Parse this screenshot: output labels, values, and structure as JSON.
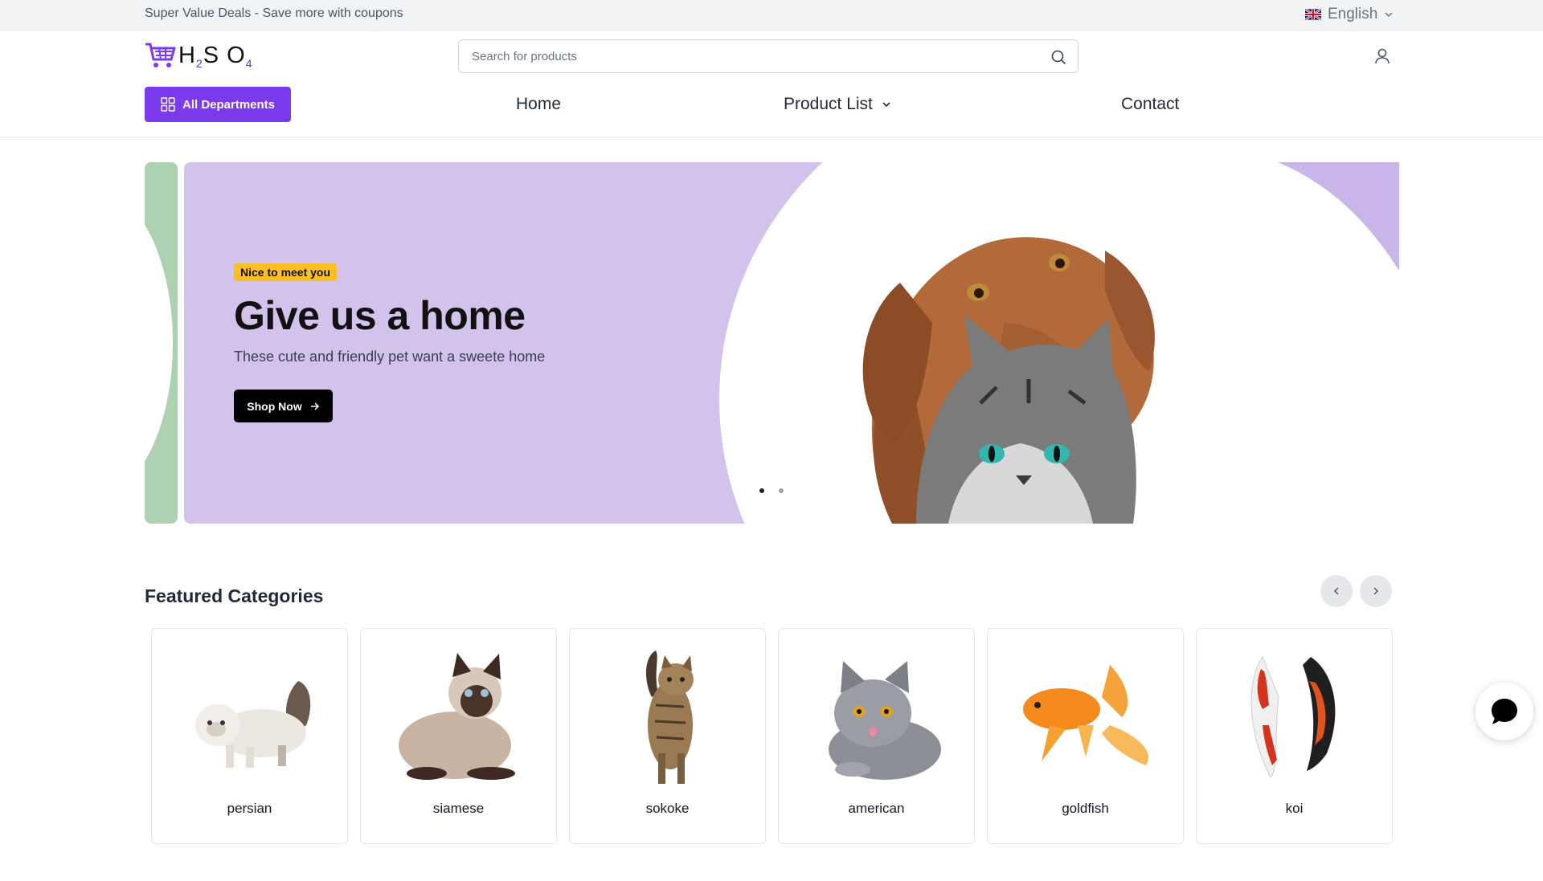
{
  "topbar": {
    "promo": "Super Value Deals - Save more with coupons",
    "language": "English",
    "language_flag_icon": "uk-flag-icon"
  },
  "header": {
    "logo_text": "HSO",
    "logo_sub_1": "2",
    "logo_sub_2": "4",
    "logo_icon": "shopping-cart-icon",
    "search_placeholder": "Search for products",
    "search_value": "",
    "user_icon": "user-icon"
  },
  "nav": {
    "departments_label": "All Departments",
    "items": [
      {
        "label": "Home"
      },
      {
        "label": "Product List",
        "has_dropdown": true
      },
      {
        "label": "Contact"
      }
    ]
  },
  "hero": {
    "badge": "Nice to meet you",
    "title": "Give us a home",
    "subtitle": "These cute and friendly pet want a sweete home",
    "cta_label": "Shop Now",
    "slides": 2,
    "active_slide": 1
  },
  "featured": {
    "title": "Featured Categories",
    "categories": [
      {
        "name": "persian"
      },
      {
        "name": "siamese"
      },
      {
        "name": "sokoke"
      },
      {
        "name": "american"
      },
      {
        "name": "goldfish"
      },
      {
        "name": "koi"
      }
    ]
  },
  "colors": {
    "brand": "#7c3aed",
    "hero_bg": "#d2c2ec",
    "hero_side": "#aed1b2",
    "badge": "#fbbf24"
  }
}
